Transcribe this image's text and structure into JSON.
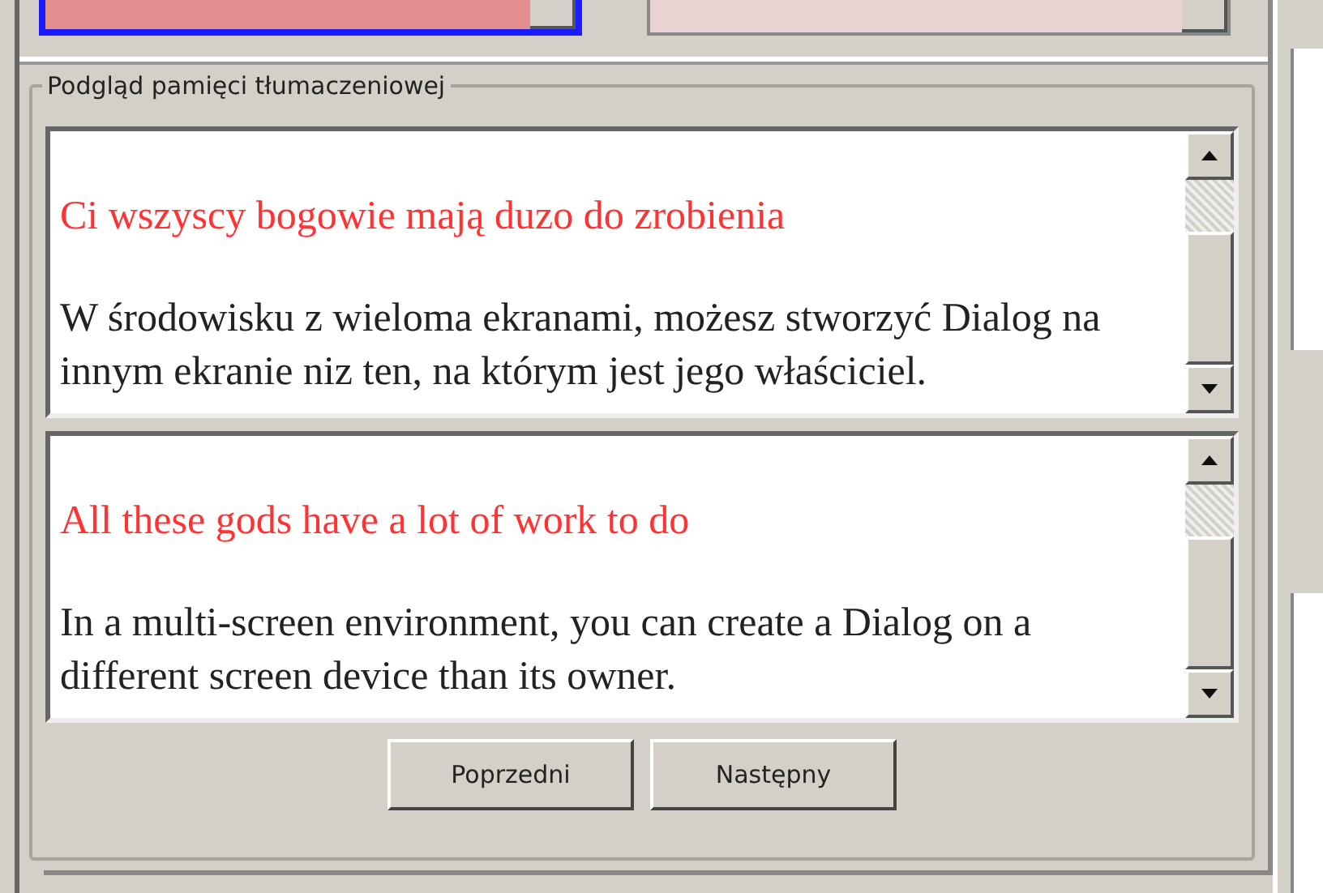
{
  "top_fields": [
    {
      "selected": true
    },
    {
      "selected": false
    }
  ],
  "group": {
    "title": "Podgląd pamięci tłumaczeniowej"
  },
  "panes": [
    {
      "heading": "Ci wszyscy bogowie mają duzo do zrobienia",
      "text": "W środowisku z wieloma ekranami, możesz stworzyć Dialog na innym ekranie niz ten, na którym jest jego właściciel."
    },
    {
      "heading": "All these gods have a lot of work to do",
      "text": "In a multi-screen environment, you can create a Dialog on a different screen device than its owner."
    }
  ],
  "buttons": [
    {
      "label": "Poprzedni"
    },
    {
      "label": "Następny"
    }
  ]
}
